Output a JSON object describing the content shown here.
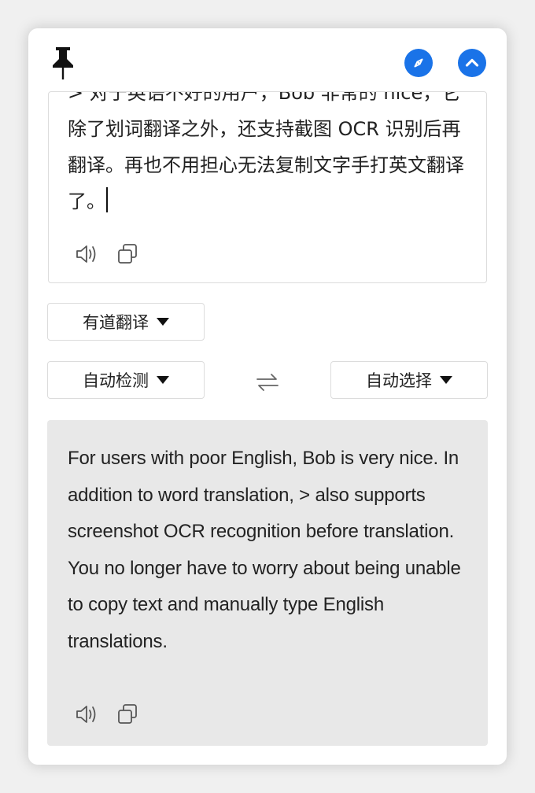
{
  "input": {
    "text": "> 对于英语不好的用户，Bob 非常的 nice，它除了划词翻译之外，还支持截图 OCR 识别后再翻译。再也不用担心无法复制文字手打英文翻译了。"
  },
  "service": {
    "label": "有道翻译"
  },
  "source_lang": {
    "label": "自动检测"
  },
  "target_lang": {
    "label": "自动选择"
  },
  "result": {
    "text": "For users with poor English, Bob is very nice. In addition to word translation, > also supports screenshot OCR recognition before translation. You no longer have to worry about being unable to copy text and manually type English translations."
  },
  "colors": {
    "accent": "#1a73e8",
    "result_bg": "#e8e8e8",
    "border": "#dcdcdc"
  },
  "icons": [
    "pin-icon",
    "compass-icon",
    "chevron-up-icon",
    "speaker-icon",
    "copy-icon",
    "swap-icon",
    "caret-down-icon"
  ]
}
